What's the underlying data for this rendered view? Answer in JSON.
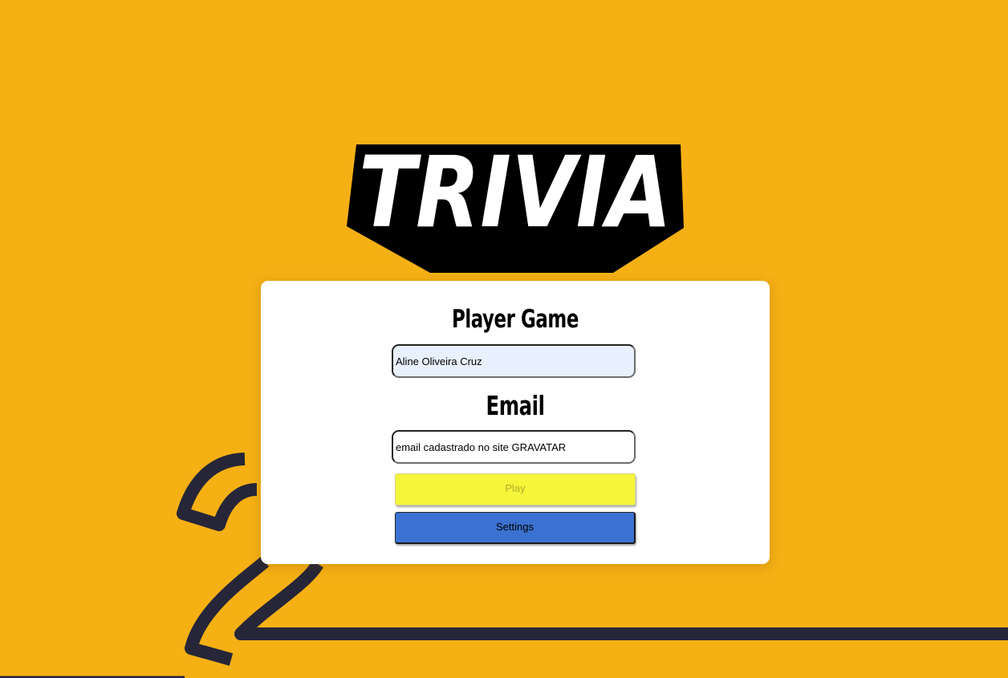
{
  "app": {
    "logo_text": "TRIVIA"
  },
  "form": {
    "player_heading": "Player Game",
    "player_value": "Aline Oliveira Cruz",
    "email_heading": "Email",
    "email_placeholder": "email cadastrado no site GRAVATAR",
    "play_label": "Play",
    "settings_label": "Settings"
  },
  "colors": {
    "background": "#f5b014",
    "decoration": "#262638",
    "card": "#ffffff",
    "play_button": "#f5f53a",
    "settings_button": "#3b71d0",
    "autofill_field": "#e8f0fe"
  }
}
